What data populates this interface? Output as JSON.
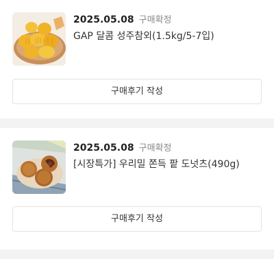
{
  "orders": [
    {
      "date": "2025.05.08",
      "status": "구매확정",
      "product_name": "GAP 달콤 성주참외(1.5kg/5-7입)",
      "thumbnail_icon": "korean-melon-photo",
      "review_button_label": "구매후기 작성"
    },
    {
      "date": "2025.05.08",
      "status": "구매확정",
      "product_name": "[시장특가] 우리밀 쫀득 팥 도넛츠(490g)",
      "thumbnail_icon": "red-bean-donut-photo",
      "review_button_label": "구매후기 작성"
    }
  ],
  "colors": {
    "background": "#ffffff",
    "separator": "#f3f3f3",
    "status_text": "#888888",
    "button_border": "#e3e3e3"
  }
}
